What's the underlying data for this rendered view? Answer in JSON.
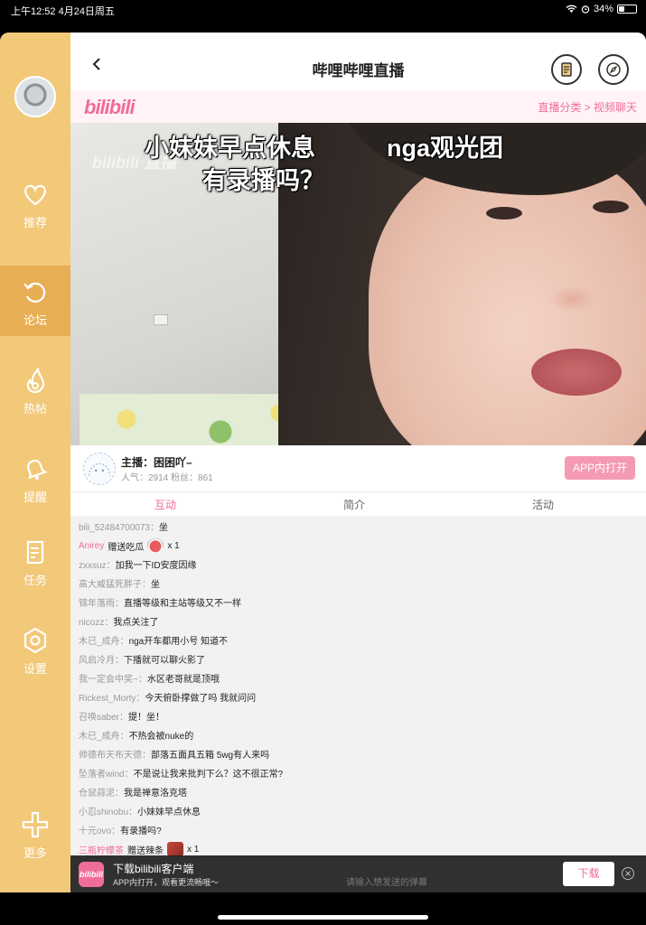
{
  "status": {
    "time_date": "上午12:52   4月24日周五",
    "battery": "34%",
    "battery_level": 0.34
  },
  "sidebar": {
    "items": [
      {
        "label": "推荐",
        "icon": "heart-icon"
      },
      {
        "label": "论坛",
        "icon": "refresh-icon"
      },
      {
        "label": "热帖",
        "icon": "flame-icon"
      },
      {
        "label": "提醒",
        "icon": "bell-icon"
      },
      {
        "label": "任务",
        "icon": "task-icon"
      },
      {
        "label": "设置",
        "icon": "hexagon-settings-icon"
      },
      {
        "label": "更多",
        "icon": "plus-icon"
      }
    ],
    "active_label": "论坛"
  },
  "header": {
    "title": "哔哩哔哩直播",
    "back_icon": "chevron-left-icon",
    "right_icons": [
      "bookmark-list-icon",
      "compass-icon"
    ]
  },
  "bili": {
    "logo": "bilibili",
    "breadcrumb": "直播分类 > 视频聊天"
  },
  "video": {
    "watermark": "bilibili 直播",
    "caption_line1_left": "小妹妹早点休息",
    "caption_line1_right": "nga观光团",
    "caption_line2": "有录播吗？"
  },
  "anchor": {
    "name": "主播：困困吖–",
    "stats": "人气：2914   粉丝：861",
    "open_button": "APP内打开"
  },
  "tabs": [
    "互动",
    "简介",
    "活动"
  ],
  "chat": [
    {
      "user": "bili_52484700073：",
      "text": "坐"
    },
    {
      "user": "Anirey",
      "text": "赠送吃瓜",
      "gift": true,
      "count": "x 1"
    },
    {
      "user": "zxxsuz：",
      "text": "加我一下ID安度因缘"
    },
    {
      "user": "高大威猛死胖子：",
      "text": "坐"
    },
    {
      "user": "锦年落雨：",
      "text": "直播等级和主站等级又不一样"
    },
    {
      "user": "nicozz：",
      "text": "我点关注了"
    },
    {
      "user": "木已_成舟：",
      "text": "nga开车都用小号 知道不"
    },
    {
      "user": "风启冷月：",
      "text": "下播就可以聊火影了"
    },
    {
      "user": "我一定会中奖~：",
      "text": "水区老哥就是顶哦"
    },
    {
      "user": "Rickest_Morty：",
      "text": "今天俯卧撑做了吗 我就问问"
    },
    {
      "user": "召唤saber：",
      "text": "提！坐！"
    },
    {
      "user": "木已_成舟：",
      "text": "不热会被nuke的"
    },
    {
      "user": "帅德布天布天德：",
      "text": "部落五面具五箱 5wg有人来吗"
    },
    {
      "user": "坠落者wind：",
      "text": "不是说让我来批判下么？这不很正常?"
    },
    {
      "user": "仓鼠蒜泥：",
      "text": "我是禅意洛克塔"
    },
    {
      "user": "小忍shinobu：",
      "text": "小妹妹早点休息"
    },
    {
      "user": "十元ovo：",
      "text": "有录播吗?"
    },
    {
      "user": "三瓶柠檬茶",
      "text": "赠送辣条",
      "gift": true,
      "count": "x 1"
    }
  ],
  "download": {
    "logo": "bilibili",
    "title": "下载bilibili客户端",
    "subtitle": "APP内打开，观看更流畅哦～",
    "input_placeholder": "请输入想发送的弹幕",
    "button": "下载"
  },
  "colors": {
    "sidebar": "#f2c879",
    "sidebar_active": "#e8ae54",
    "accent_pink": "#f06d99"
  }
}
